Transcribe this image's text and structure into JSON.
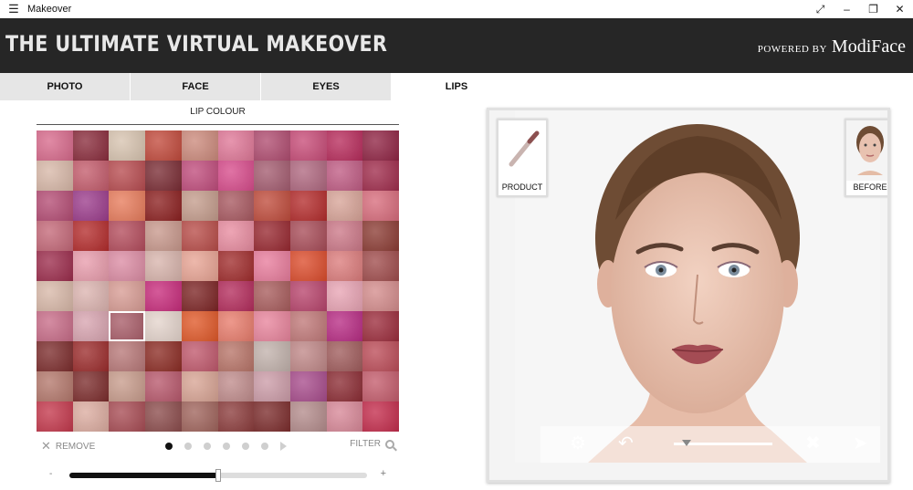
{
  "window": {
    "menu_icon": "hamburger-icon",
    "title": "Makeover",
    "controls": [
      "resize-icon",
      "minimize-icon",
      "restore-icon",
      "close-icon"
    ]
  },
  "header": {
    "brand": "THE ULTIMATE VIRTUAL MAKEOVER",
    "powered_by": "POWERED BY",
    "powered_brand": "ModiFace"
  },
  "tabs": [
    {
      "label": "PHOTO",
      "active": false
    },
    {
      "label": "FACE",
      "active": false
    },
    {
      "label": "EYES",
      "active": false
    },
    {
      "label": "LIPS",
      "active": true
    }
  ],
  "left_panel": {
    "section_title": "LIP COLOUR",
    "swatch_grid": {
      "rows": 10,
      "cols": 10,
      "selected_index": 62,
      "colors": [
        "#d86a8c",
        "#8a2c3c",
        "#d8c4b0",
        "#c24a3c",
        "#cc8a7c",
        "#e07898",
        "#b04c70",
        "#c84c78",
        "#b82c5c",
        "#902444",
        "#d8b8a8",
        "#c45c6c",
        "#b84c50",
        "#7a2c34",
        "#c04c7c",
        "#d84c8c",
        "#a45c70",
        "#b06880",
        "#c05c84",
        "#a02c4c",
        "#b44c74",
        "#9c3c8c",
        "#e87c5c",
        "#8c2020",
        "#c49c8c",
        "#a85860",
        "#c04c3c",
        "#b42c2c",
        "#d8a498",
        "#d86c7c",
        "#c46878",
        "#b42c2c",
        "#b44c5c",
        "#c8988c",
        "#b84c48",
        "#e88ca0",
        "#982830",
        "#a84c58",
        "#cc7888",
        "#8c3c34",
        "#9c2c4c",
        "#e89cac",
        "#dc8ca4",
        "#d8b4ac",
        "#e8a494",
        "#a02c2c",
        "#e87c9c",
        "#dc4c2c",
        "#dc7c7c",
        "#a04c4c",
        "#d8b8a8",
        "#dcb4b0",
        "#d89c94",
        "#c82c7c",
        "#7c2424",
        "#b42c5c",
        "#a85c5c",
        "#b8446c",
        "#e8a4b4",
        "#d48c8c",
        "#c86c88",
        "#d8a4b0",
        "#a85c68",
        "#e4d4cc",
        "#e05828",
        "#e87c6c",
        "#e8849c",
        "#c07878",
        "#b82c84",
        "#9c2c3c",
        "#7c2c2c",
        "#9c2c2c",
        "#b87878",
        "#8c2c24",
        "#c0586c",
        "#b87468",
        "#c2b2ac",
        "#c08888",
        "#a05c5c",
        "#bc4c58",
        "#b4786c",
        "#7c2c2c",
        "#c89c8c",
        "#b8586c",
        "#d8a494",
        "#c08c8c",
        "#cc9ca8",
        "#a84c8c",
        "#8c2c34",
        "#c45c6c",
        "#c4384c",
        "#dcaca0",
        "#a84c54",
        "#8c4c4c",
        "#a0645c",
        "#8c3c3c",
        "#7c2c2c",
        "#b48c8c",
        "#d88898",
        "#c42c4c"
      ]
    },
    "remove_label": "REMOVE",
    "pager": {
      "pages": 6,
      "current": 0
    },
    "filter_label": "FILTER",
    "intensity": {
      "minus": "-",
      "plus": "+",
      "value": 0.5
    }
  },
  "viewer": {
    "product_label": "PRODUCT",
    "before_label": "BEFORE",
    "tools": [
      "settings-gear-icon",
      "undo-icon",
      "close-x-icon",
      "send-icon"
    ],
    "comparison_level": 0.08
  }
}
